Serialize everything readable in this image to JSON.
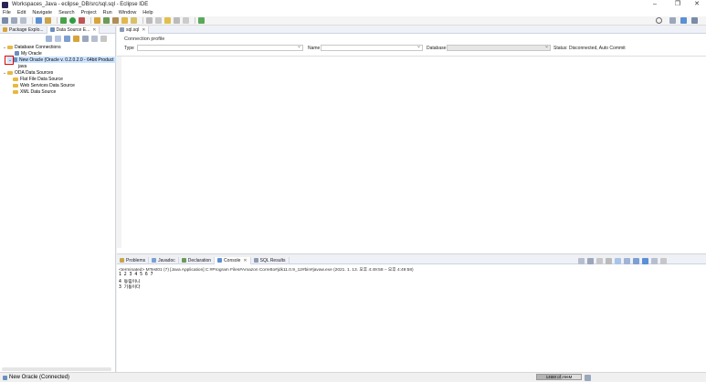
{
  "window": {
    "title": "Workspaces_Java - eclipse_DB/src/sql.sql - Eclipse IDE",
    "controls": [
      "–",
      "❐",
      "✕"
    ]
  },
  "menu": [
    "File",
    "Edit",
    "Navigate",
    "Search",
    "Project",
    "Run",
    "Window",
    "Help"
  ],
  "left_tabs": [
    {
      "label": "Package Explo...",
      "close": "✕"
    },
    {
      "label": "Data Source E...",
      "close": "✕"
    }
  ],
  "tree": {
    "db_connections": "Database Connections",
    "my_oracle": "My Oracle",
    "new_oracle": "New Oracle (Oracle v. 0.2.0.2.0 - 64bit Product",
    "java": "java",
    "oda_sources": "ODA Data Sources",
    "flat_file": "Flat File Data Source",
    "web_services": "Web Services Data Source",
    "xml": "XML Data Source"
  },
  "editor": {
    "tab_label": "sql.sql",
    "tab_close": "✕",
    "connection_profile": "Connection profile",
    "type_label": "Type",
    "name_label": "Name",
    "database_label": "Database",
    "status": "Status: Disconnected, Auto Commit"
  },
  "bottom_tabs": [
    "Problems",
    "Javadoc",
    "Declaration",
    "Console",
    "SQL Results"
  ],
  "console": {
    "terminated": "<terminated> MTest01 (7) [Java Application] C:#Program Files#Amazon Corretto#jdk11.0.9_12#bin#javaw.exe  (2021. 1. 13. 오후 4:49:58 – 오후 4:49:58)",
    "lines": [
      "1 2 3 4 5 6 7",
      "4 동림이니",
      "3 기동이다"
    ]
  },
  "statusbar": {
    "text": "New Oracle (Connected)",
    "heap": "146M of 256M"
  },
  "heap_used_fraction": 0.57,
  "colors": {
    "selection": "#cde4ff",
    "highlight_border": "#e00000",
    "folder": "#e8b842"
  }
}
